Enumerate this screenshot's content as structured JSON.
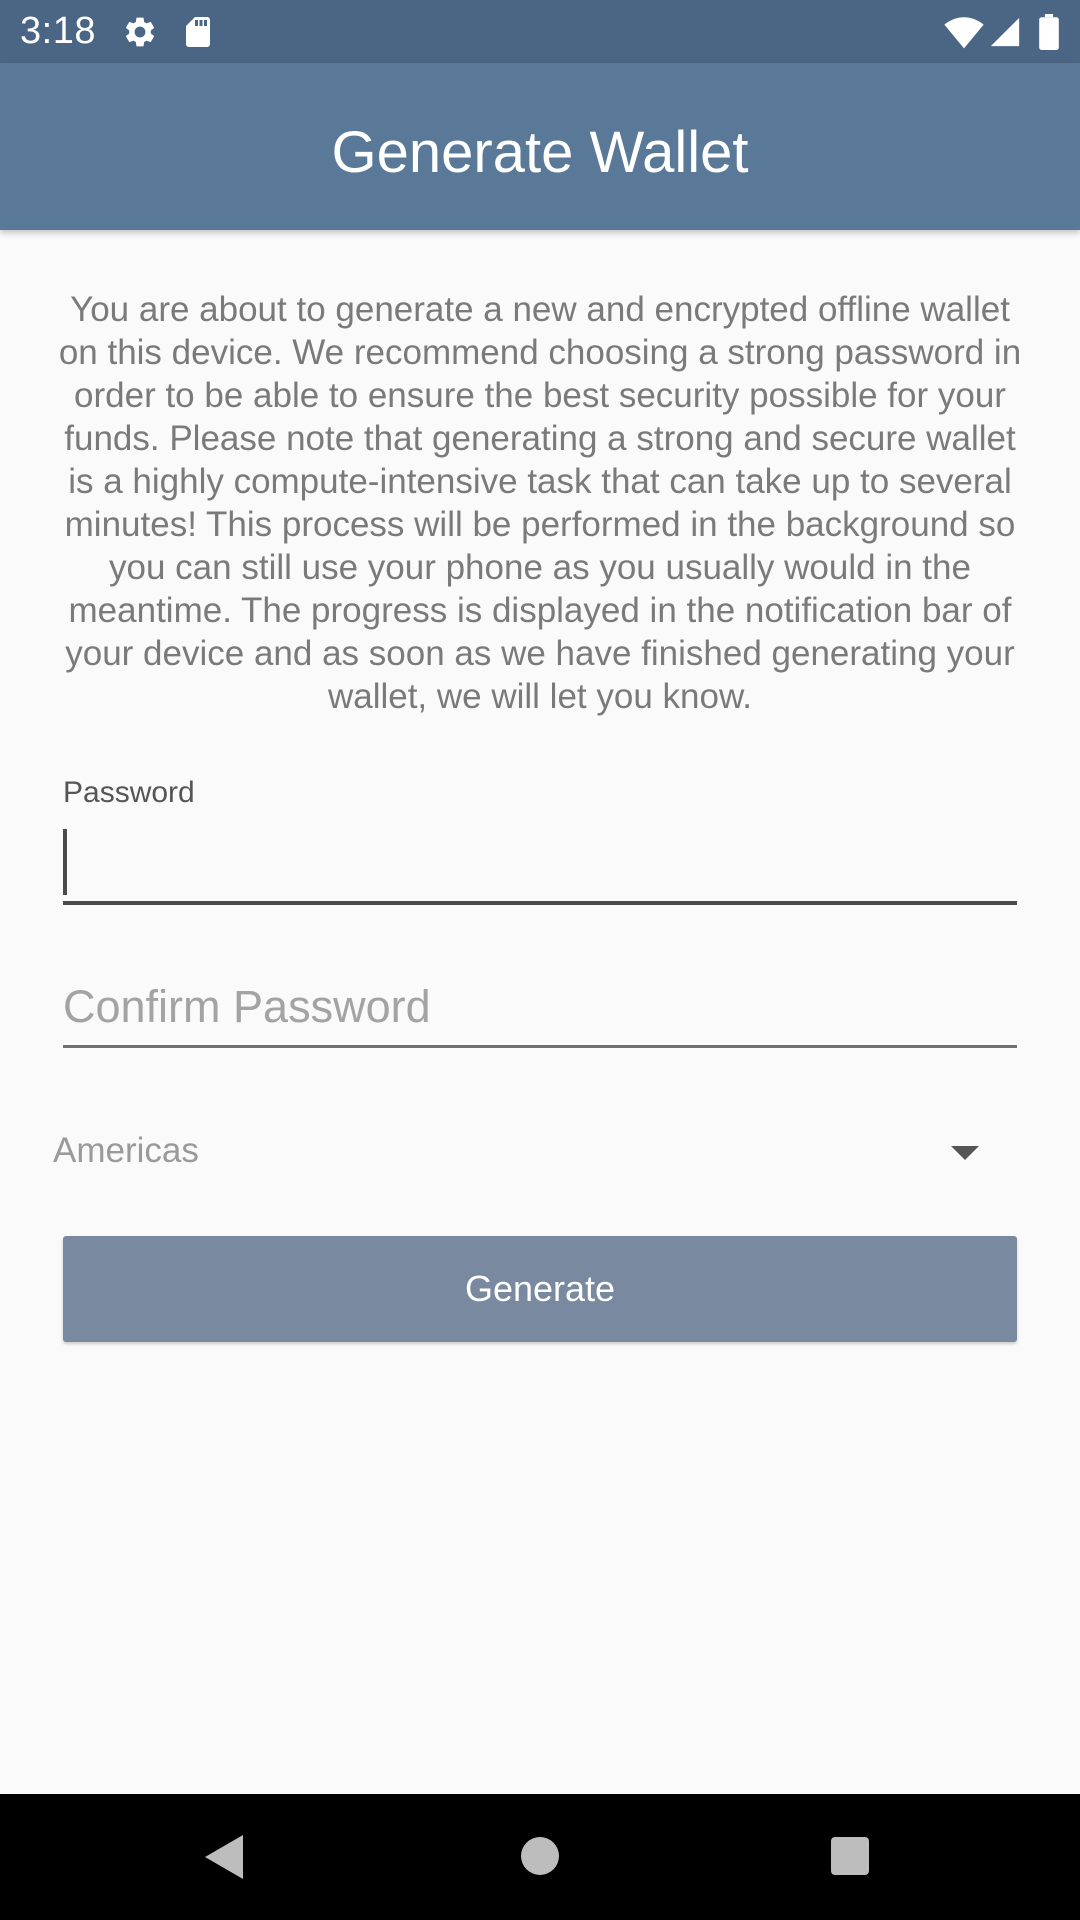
{
  "status_bar": {
    "time": "3:18",
    "icons": [
      "gear-icon",
      "sd-card-icon",
      "wifi-icon",
      "signal-icon",
      "battery-icon"
    ]
  },
  "app_bar": {
    "title": "Generate Wallet"
  },
  "description": "You are about to generate a new and encrypted offline wallet on this device. We recommend choosing a strong password in order to be able to ensure the best security possible for your funds. Please note that generating a strong and secure wallet is a highly compute-intensive task that can take up to several minutes! This process will be performed in the background so you can still use your phone as you usually would in the meantime. The progress is displayed in the notification bar of your device and as soon as we have finished generating your wallet, we will let you know.",
  "form": {
    "password_label": "Password",
    "password_value": "",
    "confirm_placeholder": "Confirm Password",
    "confirm_value": "",
    "region_selected": "Americas",
    "generate_label": "Generate"
  },
  "nav_bar": {
    "buttons": [
      "back-icon",
      "home-icon",
      "recents-icon"
    ]
  },
  "colors": {
    "status_bar": "#4b6584",
    "app_bar": "#5a7898",
    "button": "#7889a0",
    "background": "#fafafa"
  }
}
